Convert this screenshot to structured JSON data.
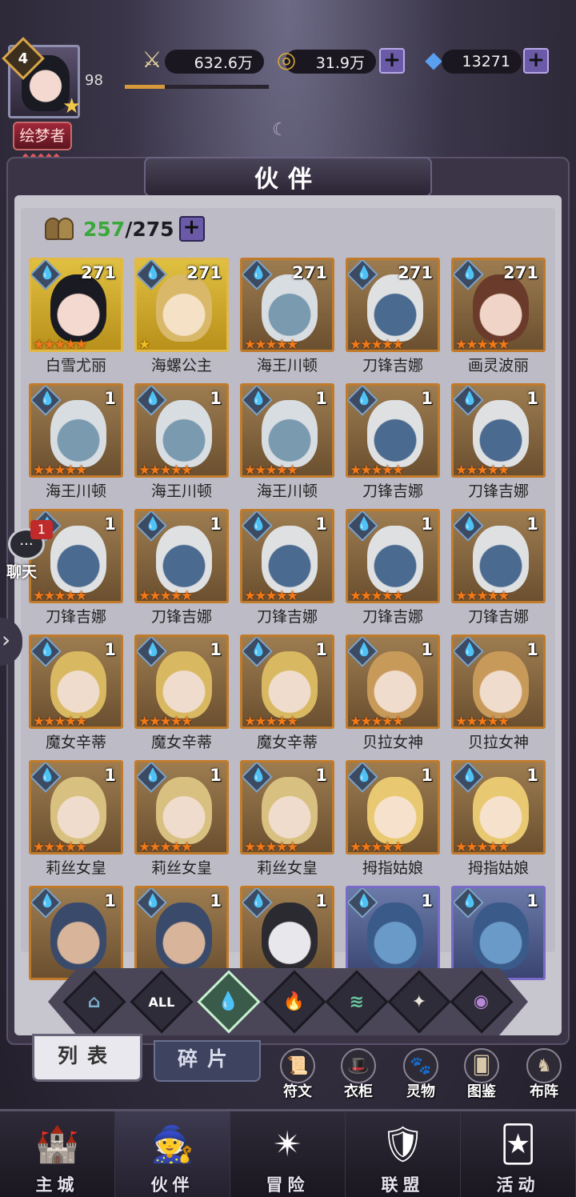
{
  "player": {
    "level": "4",
    "exp": "98",
    "exp_fill": 0.28,
    "title": "绘梦者"
  },
  "resources": {
    "power": "632.6万",
    "gold": "31.9万",
    "diamonds": "13271"
  },
  "panel": {
    "title": "伙伴"
  },
  "partner_count": {
    "current": "257",
    "max": "/275"
  },
  "partners": [
    {
      "name": "白雪尤丽",
      "level": "271",
      "stars": 5,
      "frame": "gold",
      "skin": "#f3d9d0",
      "hair": "#1a1a22"
    },
    {
      "name": "海螺公主",
      "level": "271",
      "stars": 1,
      "frame": "gold",
      "skin": "#f5e1c6",
      "hair": "#d9b86a"
    },
    {
      "name": "海王川顿",
      "level": "271",
      "stars": 5,
      "frame": "bronze",
      "skin": "#7a9ab0",
      "hair": "#d8dde2"
    },
    {
      "name": "刀锋吉娜",
      "level": "271",
      "stars": 5,
      "frame": "bronze",
      "skin": "#4a6a90",
      "hair": "#dfe0e2"
    },
    {
      "name": "画灵波丽",
      "level": "271",
      "stars": 5,
      "frame": "bronze",
      "skin": "#f0d4c8",
      "hair": "#6a3a2a"
    },
    {
      "name": "海王川顿",
      "level": "1",
      "stars": 5,
      "frame": "bronze",
      "skin": "#7a9ab0",
      "hair": "#d8dde2"
    },
    {
      "name": "海王川顿",
      "level": "1",
      "stars": 5,
      "frame": "bronze",
      "skin": "#7a9ab0",
      "hair": "#d8dde2"
    },
    {
      "name": "海王川顿",
      "level": "1",
      "stars": 5,
      "frame": "bronze",
      "skin": "#7a9ab0",
      "hair": "#d8dde2"
    },
    {
      "name": "刀锋吉娜",
      "level": "1",
      "stars": 5,
      "frame": "bronze",
      "skin": "#4a6a90",
      "hair": "#dfe0e2"
    },
    {
      "name": "刀锋吉娜",
      "level": "1",
      "stars": 5,
      "frame": "bronze",
      "skin": "#4a6a90",
      "hair": "#dfe0e2"
    },
    {
      "name": "刀锋吉娜",
      "level": "1",
      "stars": 5,
      "frame": "bronze",
      "skin": "#4a6a90",
      "hair": "#dfe0e2"
    },
    {
      "name": "刀锋吉娜",
      "level": "1",
      "stars": 5,
      "frame": "bronze",
      "skin": "#4a6a90",
      "hair": "#dfe0e2"
    },
    {
      "name": "刀锋吉娜",
      "level": "1",
      "stars": 5,
      "frame": "bronze",
      "skin": "#4a6a90",
      "hair": "#dfe0e2"
    },
    {
      "name": "刀锋吉娜",
      "level": "1",
      "stars": 5,
      "frame": "bronze",
      "skin": "#4a6a90",
      "hair": "#dfe0e2"
    },
    {
      "name": "刀锋吉娜",
      "level": "1",
      "stars": 5,
      "frame": "bronze",
      "skin": "#4a6a90",
      "hair": "#dfe0e2"
    },
    {
      "name": "魔女辛蒂",
      "level": "1",
      "stars": 5,
      "frame": "bronze",
      "skin": "#f0dccc",
      "hair": "#d8b860"
    },
    {
      "name": "魔女辛蒂",
      "level": "1",
      "stars": 5,
      "frame": "bronze",
      "skin": "#f0dccc",
      "hair": "#d8b860"
    },
    {
      "name": "魔女辛蒂",
      "level": "1",
      "stars": 5,
      "frame": "bronze",
      "skin": "#f0dccc",
      "hair": "#d8b860"
    },
    {
      "name": "贝拉女神",
      "level": "1",
      "stars": 5,
      "frame": "bronze",
      "skin": "#f0dccc",
      "hair": "#c89a5a"
    },
    {
      "name": "贝拉女神",
      "level": "1",
      "stars": 5,
      "frame": "bronze",
      "skin": "#f0dccc",
      "hair": "#c89a5a"
    },
    {
      "name": "莉丝女皇",
      "level": "1",
      "stars": 5,
      "frame": "bronze",
      "skin": "#f0dccc",
      "hair": "#d8c080"
    },
    {
      "name": "莉丝女皇",
      "level": "1",
      "stars": 5,
      "frame": "bronze",
      "skin": "#f0dccc",
      "hair": "#d8c080"
    },
    {
      "name": "莉丝女皇",
      "level": "1",
      "stars": 5,
      "frame": "bronze",
      "skin": "#f0dccc",
      "hair": "#d8c080"
    },
    {
      "name": "拇指姑娘",
      "level": "1",
      "stars": 5,
      "frame": "bronze",
      "skin": "#f6e2cc",
      "hair": "#e8c870"
    },
    {
      "name": "拇指姑娘",
      "level": "1",
      "stars": 5,
      "frame": "bronze",
      "skin": "#f6e2cc",
      "hair": "#e8c870"
    },
    {
      "name": "",
      "level": "1",
      "stars": 0,
      "frame": "bronze",
      "skin": "#d8b49a",
      "hair": "#3a4a6a"
    },
    {
      "name": "",
      "level": "1",
      "stars": 0,
      "frame": "bronze",
      "skin": "#d8b49a",
      "hair": "#3a4a6a"
    },
    {
      "name": "",
      "level": "1",
      "stars": 0,
      "frame": "bronze",
      "skin": "#e8e8ec",
      "hair": "#2a2a30"
    },
    {
      "name": "",
      "level": "1",
      "stars": 0,
      "frame": "blue",
      "skin": "#6a9ac8",
      "hair": "#3a5a8a"
    },
    {
      "name": "",
      "level": "1",
      "stars": 0,
      "frame": "blue",
      "skin": "#6a9ac8",
      "hair": "#3a5a8a"
    }
  ],
  "chat": {
    "label": "聊天",
    "badge": "1"
  },
  "filters": [
    {
      "name": "element-filter-1",
      "glyph": "⌂",
      "color": "#7ab0d0"
    },
    {
      "name": "filter-all",
      "glyph": "ALL",
      "color": "#ffffff"
    },
    {
      "name": "filter-water",
      "glyph": "💧",
      "color": "#8fd0e8",
      "active": true
    },
    {
      "name": "filter-fire",
      "glyph": "🔥",
      "color": "#e85a3a"
    },
    {
      "name": "filter-wind",
      "glyph": "≋",
      "color": "#6ac8a0"
    },
    {
      "name": "filter-light",
      "glyph": "✦",
      "color": "#e8e4d8"
    },
    {
      "name": "filter-dark",
      "glyph": "◉",
      "color": "#b888d8"
    }
  ],
  "tabs": {
    "list": "列表",
    "fragments": "碎片"
  },
  "mini_buttons": [
    {
      "label": "符文",
      "icon": "📜"
    },
    {
      "label": "衣柜",
      "icon": "🎩"
    },
    {
      "label": "灵物",
      "icon": "🐾"
    },
    {
      "label": "图鉴",
      "icon": "🂠"
    },
    {
      "label": "布阵",
      "icon": "♞"
    }
  ],
  "nav": [
    {
      "label": "主城",
      "icon": "🏰"
    },
    {
      "label": "伙伴",
      "icon": "🧙"
    },
    {
      "label": "冒险",
      "icon": "✴"
    },
    {
      "label": "联盟",
      "icon": "🛡"
    },
    {
      "label": "活动",
      "icon": "🃏"
    }
  ]
}
